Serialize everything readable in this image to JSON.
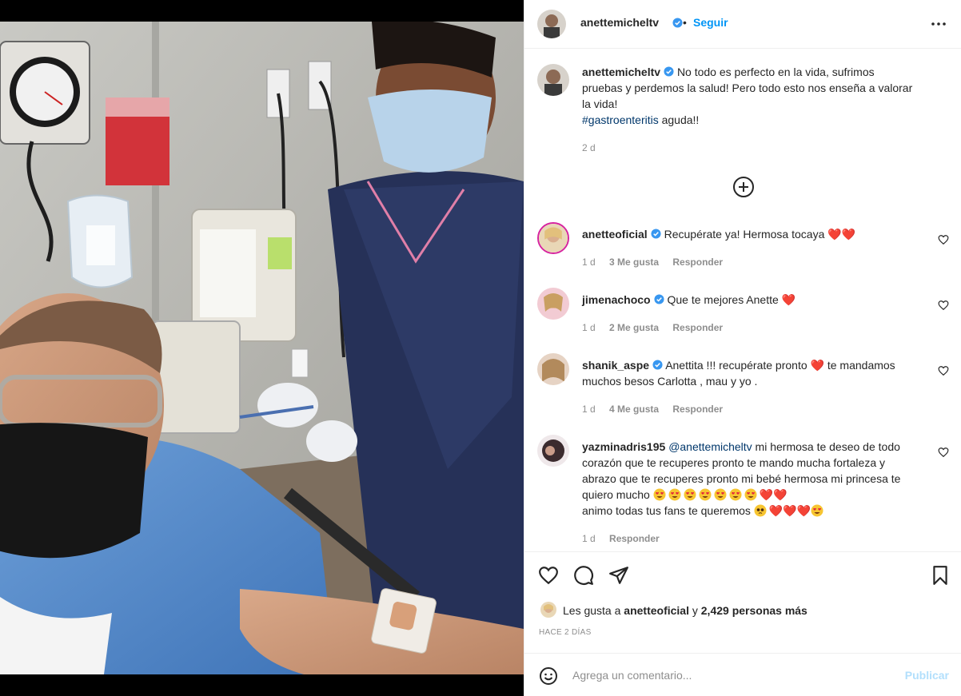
{
  "post": {
    "author": "anettemicheltv",
    "follow_label": "Seguir",
    "separator": "•",
    "caption_text": "No todo es perfecto en la vida, sufrimos pruebas y perdemos la salud! Pero todo esto nos enseña a valorar la vida!",
    "hashtag": "#gastroenteritis",
    "caption_tail": " aguda!!",
    "time": "2 d"
  },
  "comments": [
    {
      "user": "anetteoficial",
      "text": "Recupérate ya! Hermosa tocaya",
      "time": "1 d",
      "likes": "3 Me gusta",
      "reply": "Responder"
    },
    {
      "user": "jimenachoco",
      "text": "Que te mejores Anette",
      "time": "1 d",
      "likes": "2 Me gusta",
      "reply": "Responder"
    },
    {
      "user": "shanik_aspe",
      "text_a": "Anettita !!! recupérate pronto",
      "text_b": "te mandamos muchos besos Carlotta , mau y yo .",
      "time": "1 d",
      "likes": "4 Me gusta",
      "reply": "Responder"
    },
    {
      "user": "yazminadris195",
      "mention": "@anettemicheltv",
      "text_a": " mi hermosa te deseo de todo corazón que te recuperes pronto te mando mucha fortaleza y abrazo que te recuperes pronto mi bebé hermosa mi princesa te quiero mucho",
      "text_b": "animo todas tus fans te queremos",
      "time": "1 d",
      "reply": "Responder"
    }
  ],
  "engagement": {
    "likes_prefix": "Les gusta a",
    "likes_user": "anetteoficial",
    "likes_conj": "y",
    "likes_count": "2,429 personas más",
    "date": "HACE 2 DÍAS"
  },
  "composer": {
    "placeholder": "Agrega un comentario...",
    "publish_label": "Publicar"
  },
  "icons": {
    "more": "more-icon",
    "add_comments": "plus-circle-icon",
    "like": "heart-icon",
    "comment": "comment-icon",
    "share": "share-icon",
    "save": "bookmark-icon",
    "emoji": "emoji-icon",
    "verified": "verified-badge-icon"
  },
  "colors": {
    "accent": "#0095f6",
    "heart": "#ed1c24",
    "verified": "#3897f0",
    "link": "#00376b",
    "muted": "#8e8e8e"
  }
}
